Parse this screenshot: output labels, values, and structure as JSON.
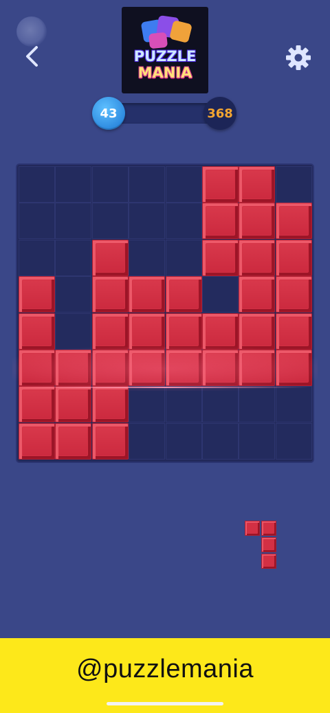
{
  "header": {
    "back_icon": "chevron-left-icon",
    "settings_icon": "gear-icon",
    "logo": {
      "line1": "PUZZLE",
      "line2": "MANIA"
    }
  },
  "progress": {
    "current_level": "43",
    "target_level": "368",
    "colors": {
      "current": "#2e8be0",
      "target_text": "#f3a531"
    }
  },
  "board": {
    "rows": 8,
    "cols": 8,
    "block_color": "#d33044",
    "grid": [
      [
        0,
        0,
        0,
        0,
        0,
        1,
        1,
        0
      ],
      [
        0,
        0,
        0,
        0,
        0,
        1,
        1,
        1
      ],
      [
        0,
        0,
        1,
        0,
        0,
        1,
        1,
        1
      ],
      [
        1,
        0,
        1,
        1,
        1,
        0,
        1,
        1
      ],
      [
        1,
        0,
        1,
        1,
        1,
        1,
        1,
        1
      ],
      [
        1,
        1,
        1,
        1,
        1,
        1,
        1,
        1
      ],
      [
        1,
        1,
        1,
        0,
        0,
        0,
        0,
        0
      ],
      [
        1,
        1,
        1,
        0,
        0,
        0,
        0,
        0
      ]
    ],
    "highlighted_row": 5
  },
  "tray": {
    "piece": [
      [
        1,
        1
      ],
      [
        0,
        1
      ],
      [
        0,
        1
      ]
    ]
  },
  "banner": {
    "handle": "@puzzlemania",
    "color": "#fde81a"
  }
}
